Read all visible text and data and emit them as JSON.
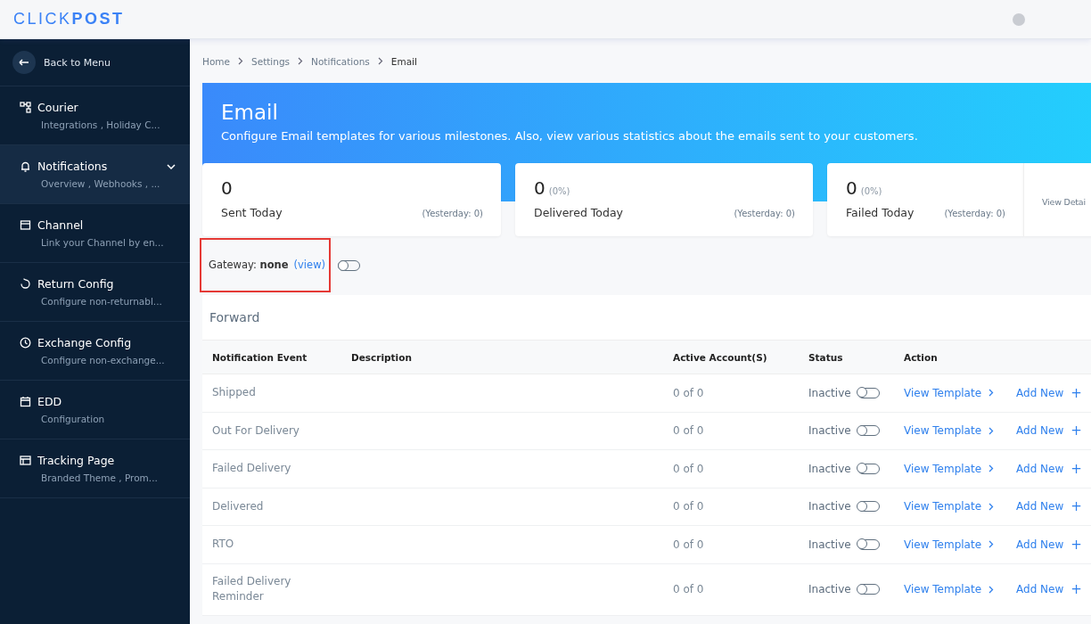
{
  "logo": "CLICK**POST**",
  "sidebar": {
    "back": "Back to Menu",
    "items": [
      {
        "kind": "courier",
        "title": "Courier",
        "subtitle": "Integrations , Holiday C...",
        "selected": false
      },
      {
        "kind": "bell",
        "title": "Notifications",
        "subtitle": "Overview , Webhooks , ...",
        "selected": true,
        "expanded": true
      },
      {
        "kind": "store",
        "title": "Channel",
        "subtitle": "Link your Channel by en...",
        "selected": false
      },
      {
        "kind": "return",
        "title": "Return Config",
        "subtitle": "Configure non-returnabl...",
        "selected": false
      },
      {
        "kind": "exchange",
        "title": "Exchange Config",
        "subtitle": "Configure non-exchange...",
        "selected": false
      },
      {
        "kind": "calendar",
        "title": "EDD",
        "subtitle": "Configuration",
        "selected": false
      },
      {
        "kind": "tracking",
        "title": "Tracking Page",
        "subtitle": "Branded Theme , Prom...",
        "selected": false
      }
    ]
  },
  "breadcrumb": [
    "Home",
    "Settings",
    "Notifications",
    "Email"
  ],
  "banner": {
    "title": "Email",
    "subtitle": "Configure Email templates for various milestones. Also, view various statistics about the emails sent to your customers."
  },
  "stats": [
    {
      "value": "0",
      "label": "Sent Today",
      "yesterday": "(Yesterday: 0)"
    },
    {
      "value": "0",
      "percent": "(0%)",
      "label": "Delivered Today",
      "yesterday": "(Yesterday: 0)"
    },
    {
      "value": "0",
      "percent": "(0%)",
      "label": "Failed Today",
      "yesterday": "(Yesterday: 0)"
    }
  ],
  "view_details": "View Detai",
  "gateway": {
    "text": "Gateway: **none**",
    "link": "(view)",
    "on": false
  },
  "section": "Forward",
  "table": {
    "columns": [
      "Notification Event",
      "Description",
      "Active Account(S)",
      "Status",
      "Action"
    ],
    "rows": [
      {
        "event": "Shipped",
        "accounts": "0 of 0",
        "status": "Inactive",
        "on": false,
        "view": "View Template",
        "add": "Add New",
        "add_sign": "+"
      },
      {
        "event": "Out For Delivery",
        "accounts": "0 of 0",
        "status": "Inactive",
        "on": false,
        "view": "View Template",
        "add": "Add New",
        "add_sign": "+"
      },
      {
        "event": "Failed Delivery",
        "accounts": "0 of 0",
        "status": "Inactive",
        "on": false,
        "view": "View Template",
        "add": "Add New",
        "add_sign": "+"
      },
      {
        "event": "Delivered",
        "accounts": "0 of 0",
        "status": "Inactive",
        "on": false,
        "view": "View Template",
        "add": "Add New",
        "add_sign": "+"
      },
      {
        "event": "RTO",
        "accounts": "0 of 0",
        "status": "Inactive",
        "on": false,
        "view": "View Template",
        "add": "Add New",
        "add_sign": "+"
      },
      {
        "event": "Failed Delivery Reminder",
        "accounts": "0 of 0",
        "status": "Inactive",
        "on": false,
        "view": "View Template",
        "add": "Add New",
        "add_sign": "+"
      }
    ]
  }
}
